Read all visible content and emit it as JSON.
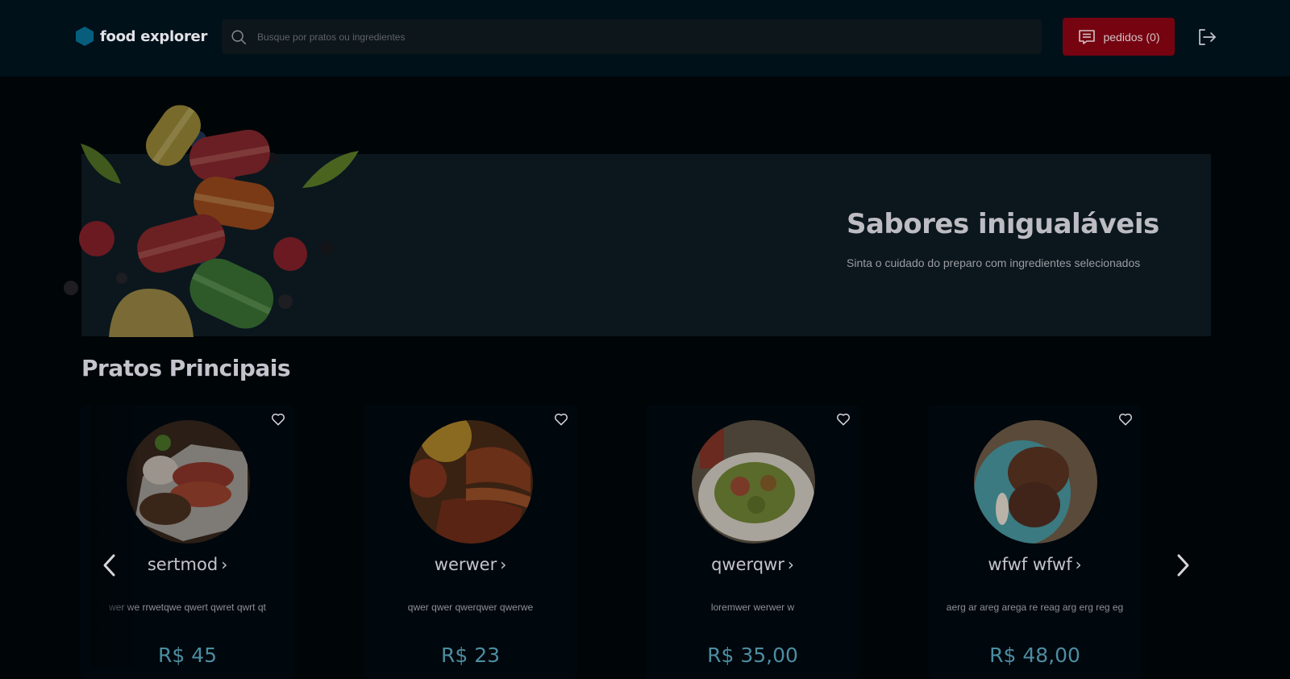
{
  "header": {
    "brand": "food explorer",
    "search_placeholder": "Busque por pratos ou ingredientes",
    "orders_label": "pedidos (0)",
    "brand_color": "#065e7c",
    "orders_color": "#750310"
  },
  "banner": {
    "title": "Sabores inigualáveis",
    "subtitle": "Sinta o cuidado do preparo com ingredientes selecionados"
  },
  "section": {
    "title": "Pratos Principais"
  },
  "dishes": [
    {
      "name": "sertmod",
      "description": "wer we rrwetqwe qwert qwret qwrt qt",
      "price": "R$ 45"
    },
    {
      "name": "werwer",
      "description": "qwer qwer qwerqwer qwerwe",
      "price": "R$ 23"
    },
    {
      "name": "qwerqwr",
      "description": "loremwer werwer w",
      "price": "R$ 35,00"
    },
    {
      "name": "wfwf wfwf",
      "description": "aerg ar areg arega re reag arg erg reg eg",
      "price": "R$ 48,00"
    }
  ],
  "icons": {
    "search": "search-icon",
    "orders": "receipt-icon",
    "logout": "sign-out-icon",
    "favorite": "heart-icon",
    "prev": "chevron-left-icon",
    "next": "chevron-right-icon"
  }
}
